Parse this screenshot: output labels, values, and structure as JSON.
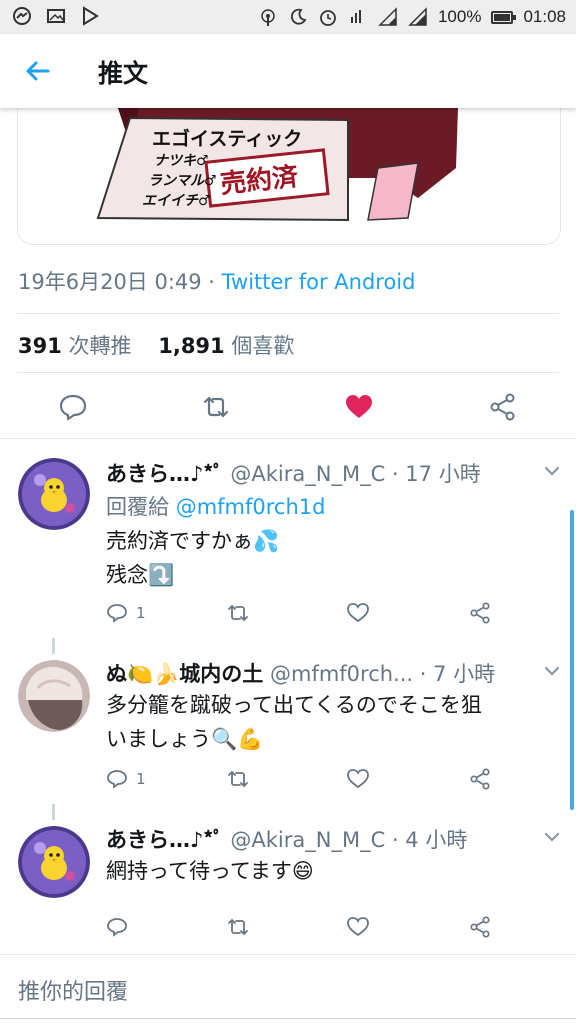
{
  "status_bar": {
    "battery": "100%",
    "battery_level": 1.0,
    "time": "01:08"
  },
  "app_bar": {
    "title": "推文"
  },
  "media": {
    "sign_title": "エゴイスティック",
    "sign_lines": [
      "ナツキ♂",
      "ランマル♂",
      "エイイチ♂"
    ],
    "stamp": "売約済"
  },
  "tweet": {
    "timestamp": "19年6月20日 0:49 · ",
    "client": "Twitter for Android",
    "retweet_count": "391",
    "retweet_label": " 次轉推",
    "like_count": "1,891",
    "like_label": " 個喜歡",
    "liked_color": "#e0245e"
  },
  "replies": [
    {
      "name": "あきら…♪*ﾟ",
      "handle": "@Akira_N_M_C",
      "time": "· 17 小時",
      "reply_to_label": "回覆給 ",
      "reply_to": "@mfmf0rch1d",
      "lines": [
        "売約済ですかぁ💦",
        "残念⤵️"
      ],
      "reply_count": "1"
    },
    {
      "name": "ぬ🍋🍌城内の土",
      "handle": "@mfmf0rch...",
      "time": "· 7 小時",
      "lines": [
        "多分籠を蹴破って出てくるのでそこを狙",
        "いましょう🔍💪"
      ],
      "reply_count": "1"
    },
    {
      "name": "あきら…♪*ﾟ",
      "handle": "@Akira_N_M_C",
      "time": "· 4 小時",
      "lines": [
        "網持って待ってます😄"
      ],
      "reply_count": ""
    }
  ],
  "compose": {
    "placeholder": "推你的回覆"
  },
  "colors": {
    "accent": "#1da1f2",
    "muted": "#657786",
    "border": "#e1e8ed"
  },
  "icons": {
    "back": "arrow-left-icon",
    "reply": "reply-icon",
    "retweet": "retweet-icon",
    "like": "heart-icon",
    "share": "share-icon",
    "more": "chevron-down-icon"
  }
}
